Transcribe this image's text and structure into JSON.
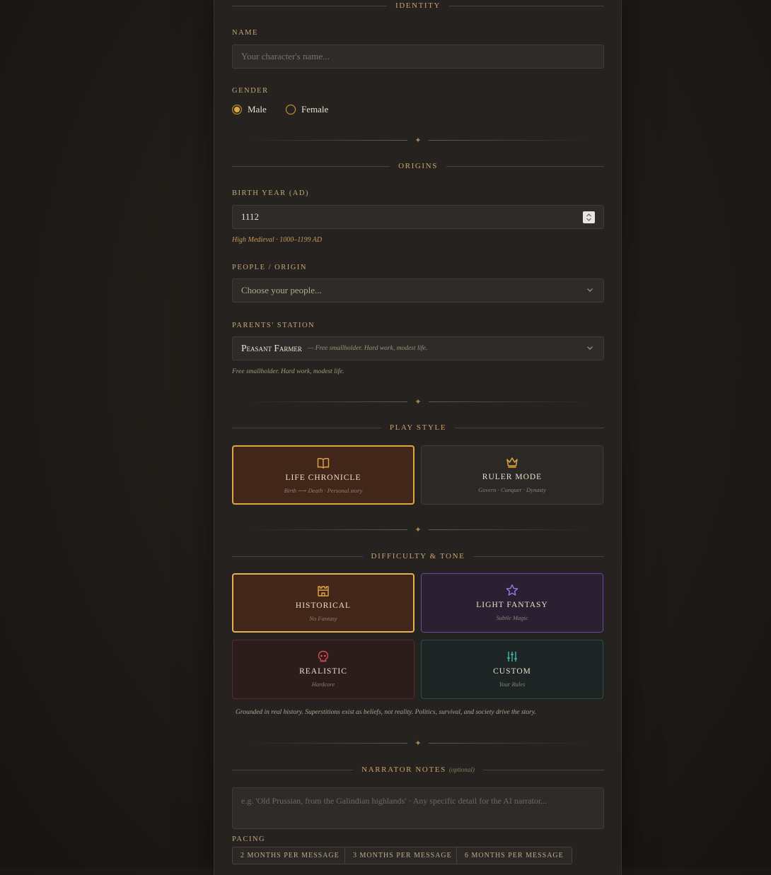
{
  "identity": {
    "section_title": "IDENTITY",
    "name_label": "NAME",
    "name_placeholder": "Your character's name...",
    "gender_label": "GENDER",
    "gender_options": [
      "Male",
      "Female"
    ],
    "gender_selected": "Male"
  },
  "origins": {
    "section_title": "ORIGINS",
    "birth_year_label": "BIRTH YEAR (AD)",
    "birth_year_value": "1112",
    "birth_year_hint": "High Medieval · 1000–1199 AD",
    "people_label": "PEOPLE / ORIGIN",
    "people_placeholder": "Choose your people...",
    "station_label": "PARENTS' STATION",
    "station_value": "Peasant Farmer",
    "station_value_desc": "— Free smallholder. Hard work, modest life.",
    "station_hint": "Free smallholder. Hard work, modest life."
  },
  "play_style": {
    "section_title": "PLAY STYLE",
    "options": [
      {
        "title": "LIFE CHRONICLE",
        "sub": "Birth ⟶ Death · Personal story",
        "icon": "book-icon",
        "selected": true
      },
      {
        "title": "RULER MODE",
        "sub": "Govern · Conquer · Dynasty",
        "icon": "crown-icon",
        "selected": false
      }
    ]
  },
  "difficulty": {
    "section_title": "DIFFICULTY & TONE",
    "options": [
      {
        "title": "HISTORICAL",
        "sub": "No Fantasy",
        "icon": "castle-icon",
        "selected": true,
        "accent": "#e0a640"
      },
      {
        "title": "LIGHT FANTASY",
        "sub": "Subtle Magic",
        "icon": "star-icon",
        "selected": false,
        "accent": "#8f6bd6"
      },
      {
        "title": "REALISTIC",
        "sub": "Hardcore",
        "icon": "skull-icon",
        "selected": false,
        "accent": "#d0524a"
      },
      {
        "title": "CUSTOM",
        "sub": "Your Rules",
        "icon": "sliders-icon",
        "selected": false,
        "accent": "#3fb8a8"
      }
    ],
    "description": "Grounded in real history. Superstitions exist as beliefs, not reality. Politics, survival, and society drive the story."
  },
  "narrator": {
    "section_title": "NARRATOR NOTES",
    "section_optional": "(optional)",
    "placeholder": "e.g. 'Old Prussian, from the Galindian highlands' · Any specific detail for the AI narrator...",
    "pacing_label": "PACING",
    "pacing_options": [
      "2 MONTHS PER MESSAGE",
      "3 MONTHS PER MESSAGE",
      "6 MONTHS PER MESSAGE"
    ]
  },
  "colors": {
    "gold": "#c9a36a",
    "selected_border": "#e0a640",
    "fantasy": "#8f6bd6",
    "realistic": "#d0524a",
    "custom": "#3fb8a8"
  }
}
